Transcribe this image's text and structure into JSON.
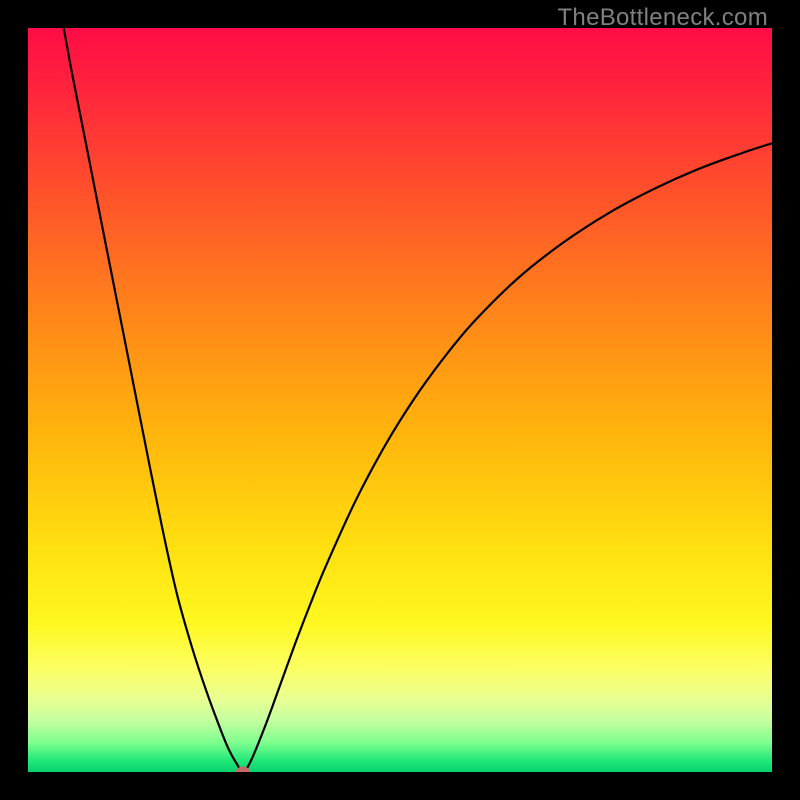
{
  "watermark": "TheBottleneck.com",
  "chart_data": {
    "type": "line",
    "title": "",
    "xlabel": "",
    "ylabel": "",
    "xlim": [
      0,
      100
    ],
    "ylim": [
      0,
      100
    ],
    "grid": false,
    "legend": false,
    "background_gradient_stops": [
      {
        "offset": 0.0,
        "color": "#ff0c46"
      },
      {
        "offset": 0.1,
        "color": "#ff2a3a"
      },
      {
        "offset": 0.25,
        "color": "#ff5a28"
      },
      {
        "offset": 0.4,
        "color": "#ff8a18"
      },
      {
        "offset": 0.55,
        "color": "#ffb60c"
      },
      {
        "offset": 0.7,
        "color": "#ffe010"
      },
      {
        "offset": 0.8,
        "color": "#fff820"
      },
      {
        "offset": 0.86,
        "color": "#fcff62"
      },
      {
        "offset": 0.9,
        "color": "#eaff90"
      },
      {
        "offset": 0.93,
        "color": "#c6ffa0"
      },
      {
        "offset": 0.96,
        "color": "#80ff90"
      },
      {
        "offset": 0.985,
        "color": "#20e878"
      },
      {
        "offset": 1.0,
        "color": "#08d070"
      }
    ],
    "series": [
      {
        "name": "curve",
        "x": [
          4.8,
          6,
          8,
          10,
          12,
          14,
          16,
          18,
          20,
          22,
          24,
          26,
          27,
          28,
          28.9,
          30,
          32,
          34,
          36,
          38,
          40,
          44,
          48,
          52,
          56,
          60,
          66,
          72,
          78,
          84,
          90,
          96,
          100
        ],
        "y": [
          100,
          93.5,
          83.4,
          73.2,
          63.1,
          53.0,
          42.9,
          33.0,
          24.0,
          16.9,
          10.8,
          5.4,
          3.0,
          1.2,
          0.06,
          1.6,
          6.5,
          12.0,
          17.5,
          22.7,
          27.6,
          36.4,
          43.9,
          50.3,
          55.8,
          60.6,
          66.5,
          71.2,
          75.1,
          78.3,
          81.0,
          83.2,
          84.5
        ]
      }
    ],
    "minimum_marker": {
      "x": 28.9,
      "y": 0.06,
      "color": "#c56a6a"
    }
  }
}
